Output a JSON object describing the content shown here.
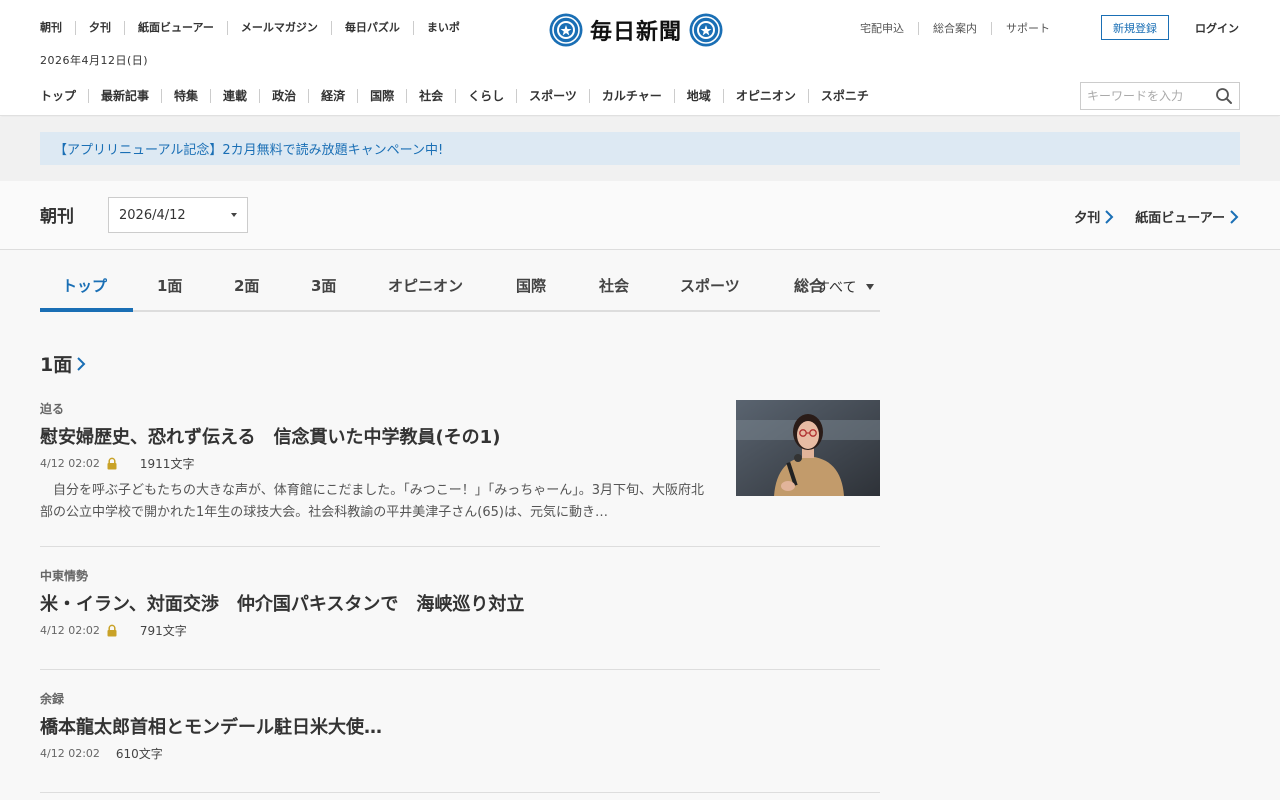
{
  "header": {
    "util_nav": [
      "朝刊",
      "夕刊",
      "紙面ビューアー",
      "メールマガジン",
      "毎日パズル",
      "まいポ"
    ],
    "date": "2026年4月12日(日)",
    "logo_text": "毎日新聞",
    "right_links": [
      "宅配申込",
      "総合案内",
      "サポート"
    ],
    "register_label": "新規登録",
    "login_label": "ログイン",
    "main_nav": [
      "トップ",
      "最新記事",
      "特集",
      "連載",
      "政治",
      "経済",
      "国際",
      "社会",
      "くらし",
      "スポーツ",
      "カルチャー",
      "地域",
      "オピニオン",
      "スポニチ"
    ],
    "search_placeholder": "キーワードを入力"
  },
  "banner": {
    "text": "【アプリリニューアル記念】2カ月無料で読み放題キャンペーン中!"
  },
  "edition": {
    "title": "朝刊",
    "selected_date": "2026/4/12",
    "link_evening": "夕刊",
    "link_viewer": "紙面ビューアー"
  },
  "tabs": {
    "items": [
      "トップ",
      "1面",
      "2面",
      "3面",
      "オピニオン",
      "国際",
      "社会",
      "スポーツ",
      "総合"
    ],
    "all_label": "すべて",
    "active_index": 0
  },
  "section": {
    "title": "1面"
  },
  "articles": [
    {
      "kicker": "迫る",
      "headline": "慰安婦歴史、恐れず伝える　信念貫いた中学教員(その1)",
      "time": "4/12 02:02",
      "locked": true,
      "chars": "1911文字",
      "excerpt": "　自分を呼ぶ子どもたちの大きな声が、体育館にこだました。「みつこー！」「みっちゃーん」。3月下旬、大阪府北部の公立中学校で開かれた1年生の球技大会。社会科教諭の平井美津子さん(65)は、元気に動き…"
    },
    {
      "kicker": "中東情勢",
      "headline": "米・イラン、対面交渉　仲介国パキスタンで　海峡巡り対立",
      "time": "4/12 02:02",
      "locked": true,
      "chars": "791文字"
    },
    {
      "kicker": "余録",
      "headline": "橋本龍太郎首相とモンデール駐日米大使…",
      "time": "4/12 02:02",
      "locked": false,
      "chars": "610文字"
    }
  ],
  "colors": {
    "accent": "#1a6fb5",
    "lock": "#c9a227",
    "banner_bg": "#dde9f3"
  }
}
